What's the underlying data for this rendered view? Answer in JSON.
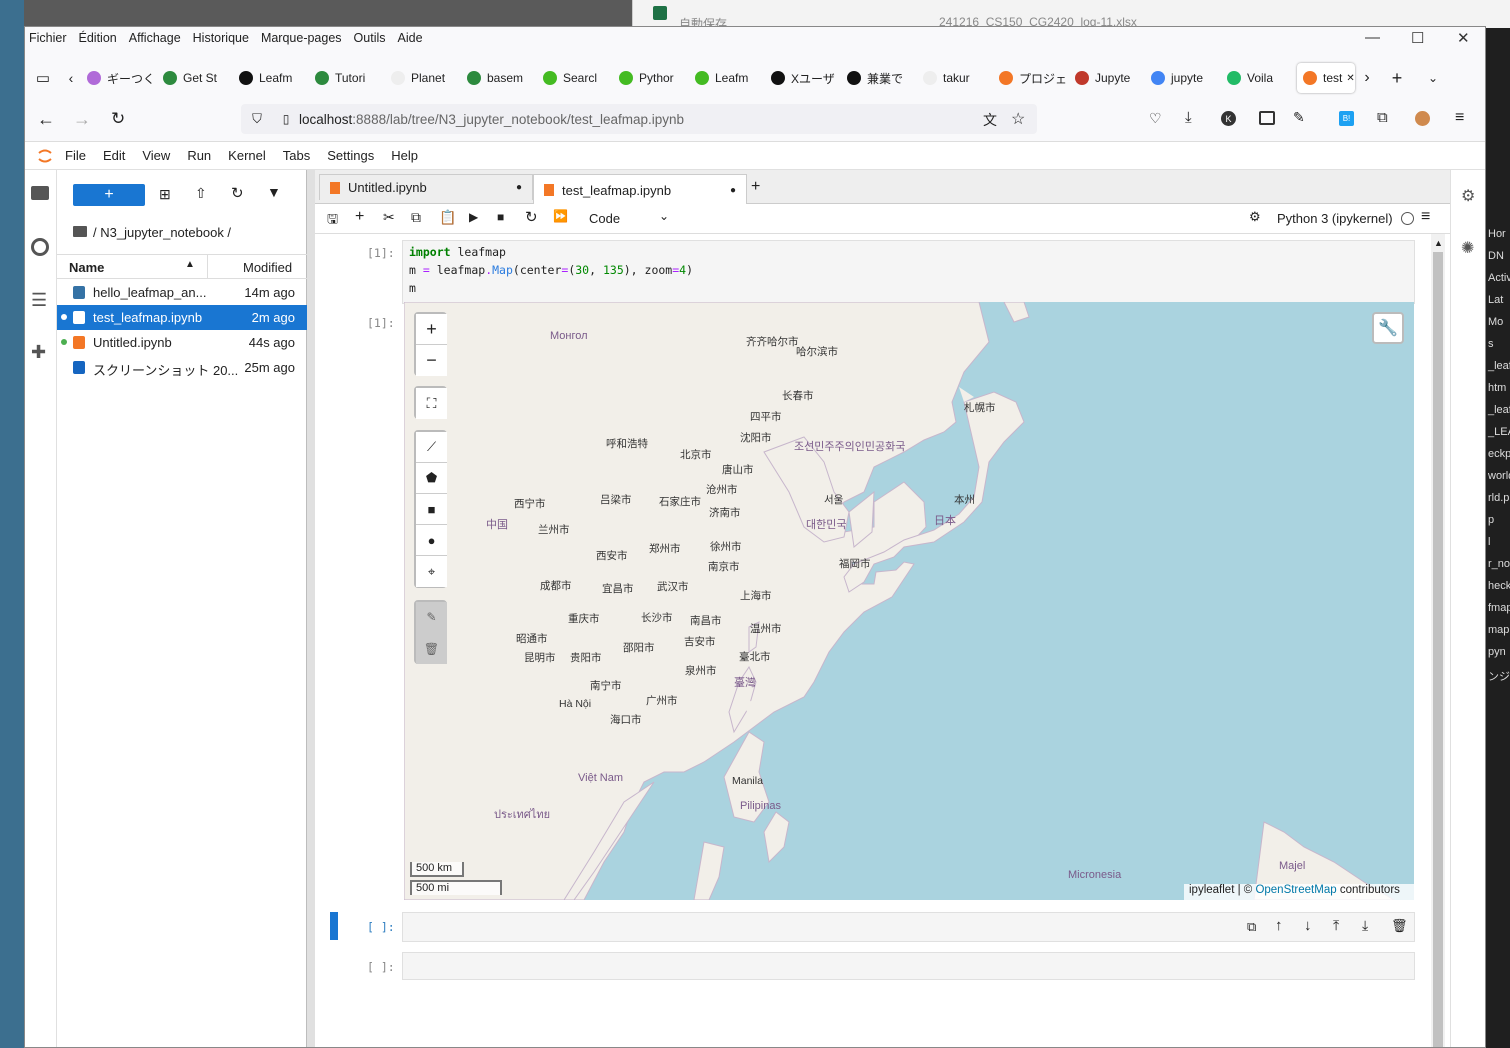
{
  "browser": {
    "menu": [
      "Fichier",
      "Édition",
      "Affichage",
      "Historique",
      "Marque-pages",
      "Outils",
      "Aide"
    ],
    "tabs": [
      {
        "label": "ギーつく",
        "color": "#b06ad8"
      },
      {
        "label": "Get St",
        "color": "#2d8a3e"
      },
      {
        "label": "Leafm",
        "color": "#111111"
      },
      {
        "label": "Tutori",
        "color": "#2d8a3e"
      },
      {
        "label": "Planet",
        "color": "#eeeeee"
      },
      {
        "label": "basem",
        "color": "#2d8a3e"
      },
      {
        "label": "Searcl",
        "color": "#44bb22"
      },
      {
        "label": "Pythor",
        "color": "#44bb22"
      },
      {
        "label": "Leafm",
        "color": "#44bb22"
      },
      {
        "label": "Xユーザ",
        "color": "#111111"
      },
      {
        "label": "兼業で",
        "color": "#111111"
      },
      {
        "label": "takur",
        "color": "#eeeeee"
      },
      {
        "label": "プロジェ",
        "color": "#f37726"
      },
      {
        "label": "Jupyte",
        "color": "#c0392b"
      },
      {
        "label": "jupyte",
        "color": "#4285f4"
      },
      {
        "label": "Voila",
        "color": "#22bb66"
      },
      {
        "label": "test",
        "color": "#f37726",
        "active": true
      }
    ],
    "url_prefix": "localhost",
    "url_rest": ":8888/lab/tree/N3_jupyter_notebook/test_leafmap.ipynb",
    "excel_title": "241216_CS150_CG2420_log-11.xlsx",
    "excel_autosave": "自動保存"
  },
  "jupyter": {
    "menu": [
      "File",
      "Edit",
      "View",
      "Run",
      "Kernel",
      "Tabs",
      "Settings",
      "Help"
    ],
    "new_button": "+",
    "breadcrumb": "/ N3_jupyter_notebook /",
    "columns": {
      "name": "Name",
      "modified": "Modified"
    },
    "files": [
      {
        "name": "hello_leafmap_an...",
        "modified": "14m ago",
        "icon": "python"
      },
      {
        "name": "test_leafmap.ipynb",
        "modified": "2m ago",
        "icon": "notebook",
        "selected": true,
        "running": true
      },
      {
        "name": "Untitled.ipynb",
        "modified": "44s ago",
        "icon": "notebook-orange",
        "running": true
      },
      {
        "name": "スクリーンショット 20...",
        "modified": "25m ago",
        "icon": "image"
      }
    ],
    "doc_tabs": [
      {
        "label": "Untitled.ipynb"
      },
      {
        "label": "test_leafmap.ipynb",
        "active": true
      }
    ],
    "cell_type": "Code",
    "kernel": "Python 3 (ipykernel)",
    "cells": [
      {
        "prompt": "[1]:",
        "lines": [
          "import leafmap",
          "m = leafmap.Map(center=(30, 135), zoom=4)",
          "m"
        ]
      },
      {
        "prompt": "[ ]:"
      },
      {
        "prompt": "[ ]:"
      }
    ],
    "output_prompt": "[1]:"
  },
  "map": {
    "zoom_in": "+",
    "zoom_out": "−",
    "scale_km": "500 km",
    "scale_mi": "500 mi",
    "attribution_prefix": "ipyleaflet | © ",
    "attribution_link": "OpenStreetMap",
    "attribution_suffix": " contributors",
    "labels": [
      {
        "text": "Монгол",
        "type": "country"
      },
      {
        "text": "齐齐哈尔市"
      },
      {
        "text": "哈尔滨市"
      },
      {
        "text": "长春市"
      },
      {
        "text": "四平市"
      },
      {
        "text": "沈阳市"
      },
      {
        "text": "札幌市"
      },
      {
        "text": "呼和浩特"
      },
      {
        "text": "北京市"
      },
      {
        "text": "唐山市"
      },
      {
        "text": "조선민주주의인민공화국",
        "type": "country"
      },
      {
        "text": "沧州市"
      },
      {
        "text": "西宁市"
      },
      {
        "text": "吕梁市"
      },
      {
        "text": "石家庄市"
      },
      {
        "text": "济南市"
      },
      {
        "text": "서울"
      },
      {
        "text": "本州"
      },
      {
        "text": "日本",
        "type": "country"
      },
      {
        "text": "中国",
        "type": "country"
      },
      {
        "text": "兰州市"
      },
      {
        "text": "대한민국",
        "type": "country"
      },
      {
        "text": "郑州市"
      },
      {
        "text": "徐州市"
      },
      {
        "text": "西安市"
      },
      {
        "text": "南京市"
      },
      {
        "text": "福岡市"
      },
      {
        "text": "成都市"
      },
      {
        "text": "宜昌市"
      },
      {
        "text": "武汉市"
      },
      {
        "text": "上海市"
      },
      {
        "text": "重庆市"
      },
      {
        "text": "长沙市"
      },
      {
        "text": "南昌市"
      },
      {
        "text": "温州市"
      },
      {
        "text": "昭通市"
      },
      {
        "text": "邵阳市"
      },
      {
        "text": "吉安市"
      },
      {
        "text": "昆明市"
      },
      {
        "text": "贵阳市"
      },
      {
        "text": "泉州市"
      },
      {
        "text": "臺北市"
      },
      {
        "text": "臺灣",
        "type": "country"
      },
      {
        "text": "南宁市"
      },
      {
        "text": "Hà Nội"
      },
      {
        "text": "广州市"
      },
      {
        "text": "海口市"
      },
      {
        "text": "Việt Nam",
        "type": "country"
      },
      {
        "text": "Manila"
      },
      {
        "text": "Pilipinas",
        "type": "country"
      },
      {
        "text": "ประเทศไทย",
        "type": "country"
      },
      {
        "text": "Micronesia",
        "type": "country"
      },
      {
        "text": "Majel",
        "type": "country"
      }
    ]
  },
  "right_panel": [
    "Hor",
    "DN",
    "Activ",
    "Lat",
    "Mo",
    "s",
    "_leaf",
    "htm",
    "_leaf",
    "_LEA",
    "eckpo",
    "world",
    "rld.p",
    "p",
    "l",
    "r_no",
    "heck",
    "fmap",
    "map.",
    "pyn",
    "ンジ"
  ]
}
